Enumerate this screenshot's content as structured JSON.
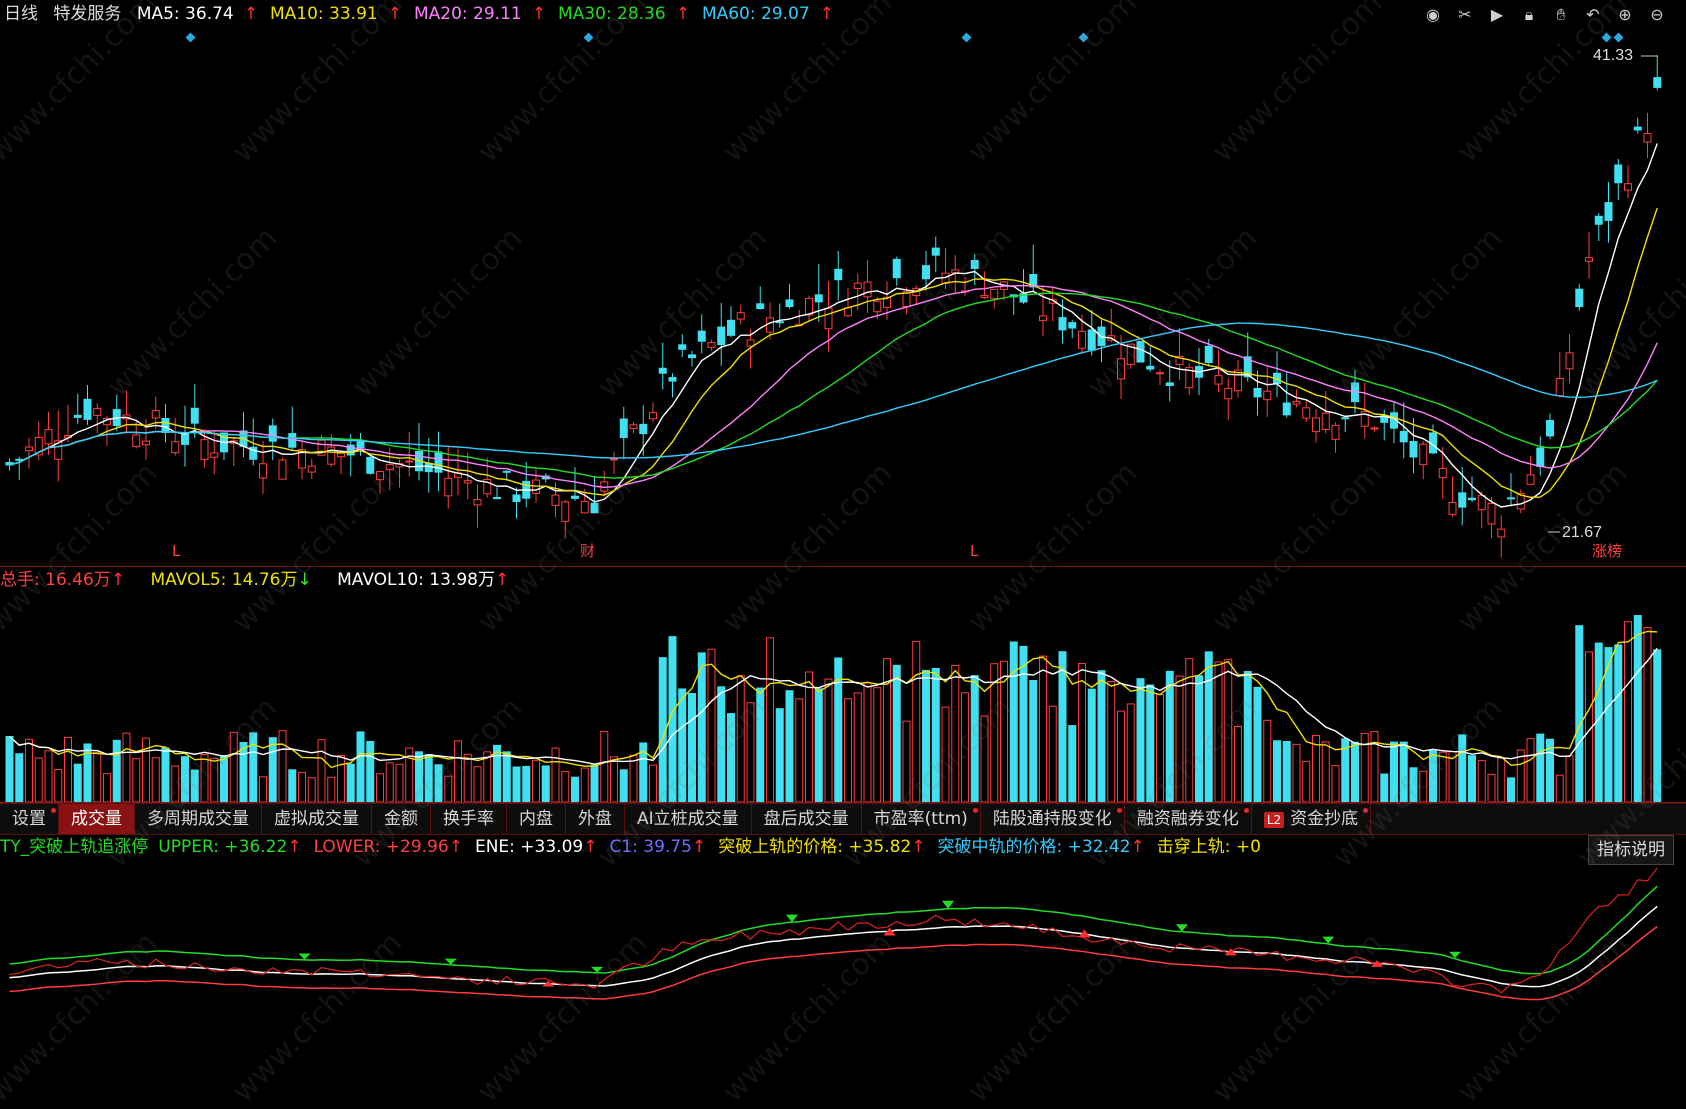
{
  "header": {
    "period": "日线",
    "stock_name": "特发服务",
    "ma": [
      {
        "label": "MA5: 36.74",
        "arrow": "↑",
        "color": "#ffffff"
      },
      {
        "label": "MA10: 33.91",
        "arrow": "↑",
        "color": "#f0e000"
      },
      {
        "label": "MA20: 29.11",
        "arrow": "↑",
        "color": "#ff80ff"
      },
      {
        "label": "MA30: 28.36",
        "arrow": "↑",
        "color": "#22dd22"
      },
      {
        "label": "MA60: 29.07",
        "arrow": "↑",
        "color": "#33ccff"
      }
    ]
  },
  "toolbar_icons": [
    "eye-icon",
    "scissors-icon",
    "play-icon",
    "lock-icon",
    "hand-icon",
    "undo-icon",
    "zoom-in-icon",
    "zoom-out-icon"
  ],
  "price_chart": {
    "high_label": "41.33",
    "low_label": "21.67",
    "markers": [
      "L",
      "财",
      "L",
      "涨榜"
    ]
  },
  "volume_header": {
    "total": {
      "label": "总手: 16.46万",
      "arrow": "↑",
      "color": "#ff4040"
    },
    "mavol5": {
      "label": "MAVOL5: 14.76万",
      "arrow": "↓",
      "color": "#f0e000"
    },
    "mavol10": {
      "label": "MAVOL10: 13.98万",
      "arrow": "↑",
      "color": "#ffffff"
    }
  },
  "tabs": [
    {
      "label": "设置",
      "active": false,
      "dot": true
    },
    {
      "label": "成交量",
      "active": true,
      "dot": false
    },
    {
      "label": "多周期成交量",
      "active": false,
      "dot": false
    },
    {
      "label": "虚拟成交量",
      "active": false,
      "dot": false
    },
    {
      "label": "金额",
      "active": false,
      "dot": false
    },
    {
      "label": "换手率",
      "active": false,
      "dot": false
    },
    {
      "label": "内盘",
      "active": false,
      "dot": false
    },
    {
      "label": "外盘",
      "active": false,
      "dot": false
    },
    {
      "label": "AI立桩成交量",
      "active": false,
      "dot": false
    },
    {
      "label": "盘后成交量",
      "active": false,
      "dot": false
    },
    {
      "label": "市盈率(ttm)",
      "active": false,
      "dot": true
    },
    {
      "label": "陆股通持股变化",
      "active": false,
      "dot": true
    },
    {
      "label": "融资融券变化",
      "active": false,
      "dot": true
    },
    {
      "label": "资金抄底",
      "active": false,
      "dot": true,
      "badge": "L2"
    }
  ],
  "indicator_header": {
    "name": {
      "label": "TY_突破上轨追涨停",
      "color": "#22dd22"
    },
    "items": [
      {
        "label": "UPPER: +36.22",
        "arrow": "↑",
        "color": "#22dd22"
      },
      {
        "label": "LOWER: +29.96",
        "arrow": "↑",
        "color": "#ff4040"
      },
      {
        "label": "ENE: +33.09",
        "arrow": "↑",
        "color": "#ffffff"
      },
      {
        "label": "C1: 39.75",
        "arrow": "↑",
        "color": "#6f6fff"
      },
      {
        "label": "突破上轨的价格: +35.82",
        "arrow": "↑",
        "color": "#f0e000"
      },
      {
        "label": "突破中轨的价格: +32.42",
        "arrow": "↑",
        "color": "#33ccff"
      },
      {
        "label": "击穿上轨: +0",
        "arrow": "",
        "color": "#f0e000"
      }
    ],
    "explain_button": "指标说明"
  },
  "colors": {
    "up": "#ff3c3c",
    "down": "#40e0f0",
    "ma5": "#ffffff",
    "ma10": "#f0e000",
    "ma20": "#ff80ff",
    "ma30": "#22dd22",
    "ma60": "#33ccff"
  },
  "watermark": "www.cfchi.com"
}
